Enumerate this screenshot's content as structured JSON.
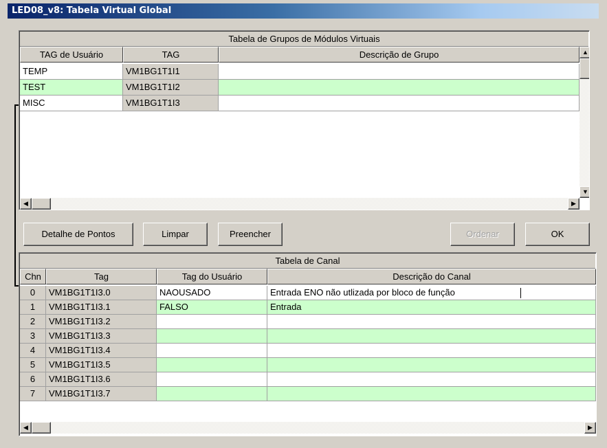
{
  "window": {
    "title": "LED08_v8: Tabela Virtual Global"
  },
  "group_table": {
    "title": "Tabela de Grupos de Módulos Virtuais",
    "columns": [
      "TAG de Usuário",
      "TAG",
      "Descrição de Grupo"
    ],
    "rows": [
      {
        "user_tag": "TEMP",
        "tag": "VM1BG1T1I1",
        "description": ""
      },
      {
        "user_tag": "TEST",
        "tag": "VM1BG1T1I2",
        "description": ""
      },
      {
        "user_tag": "MISC",
        "tag": "VM1BG1T1I3",
        "description": ""
      }
    ]
  },
  "buttons": {
    "point_detail": "Detalhe de Pontos",
    "clear": "Limpar",
    "fill": "Preencher",
    "sort": "Ordenar",
    "ok": "OK"
  },
  "channel_table": {
    "title": "Tabela de Canal",
    "columns": [
      "Chn",
      "Tag",
      "Tag do Usuário",
      "Descrição do Canal"
    ],
    "rows": [
      {
        "chn": "0",
        "tag": "VM1BG1T1I3.0",
        "user_tag": "NAOUSADO",
        "description": "Entrada ENO não utlizada por bloco de função"
      },
      {
        "chn": "1",
        "tag": "VM1BG1T1I3.1",
        "user_tag": "FALSO",
        "description": "Entrada"
      },
      {
        "chn": "2",
        "tag": "VM1BG1T1I3.2",
        "user_tag": "",
        "description": ""
      },
      {
        "chn": "3",
        "tag": "VM1BG1T1I3.3",
        "user_tag": "",
        "description": ""
      },
      {
        "chn": "4",
        "tag": "VM1BG1T1I3.4",
        "user_tag": "",
        "description": ""
      },
      {
        "chn": "5",
        "tag": "VM1BG1T1I3.5",
        "user_tag": "",
        "description": ""
      },
      {
        "chn": "6",
        "tag": "VM1BG1T1I3.6",
        "user_tag": "",
        "description": ""
      },
      {
        "chn": "7",
        "tag": "VM1BG1T1I3.7",
        "user_tag": "",
        "description": ""
      }
    ]
  },
  "colors": {
    "row_alt": "#ccffcc",
    "title_bar": "#0a246a",
    "face": "#d4d0c8"
  },
  "icons": {
    "scroll_up": "▲",
    "scroll_down": "▼",
    "scroll_left": "◀",
    "scroll_right": "▶"
  }
}
